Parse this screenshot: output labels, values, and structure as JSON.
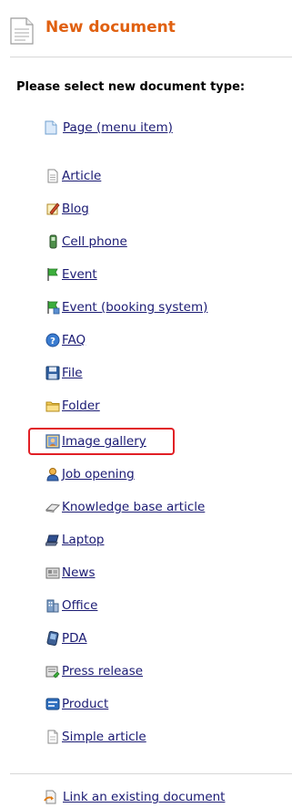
{
  "header": {
    "title": "New document",
    "icon": "document-icon"
  },
  "prompt": "Please select new document type:",
  "items": [
    {
      "label": "Page (menu item)",
      "icon": "page-icon"
    },
    {
      "label": "Article",
      "icon": "article-icon"
    },
    {
      "label": "Blog",
      "icon": "blog-icon"
    },
    {
      "label": "Cell phone",
      "icon": "cell-phone-icon"
    },
    {
      "label": "Event",
      "icon": "flag-icon"
    },
    {
      "label": "Event (booking system)",
      "icon": "booking-flag-icon"
    },
    {
      "label": "FAQ",
      "icon": "help-icon"
    },
    {
      "label": "File",
      "icon": "file-icon"
    },
    {
      "label": "Folder",
      "icon": "folder-icon"
    },
    {
      "label": "Image gallery",
      "icon": "image-gallery-icon",
      "highlighted": true
    },
    {
      "label": "Job opening",
      "icon": "person-icon"
    },
    {
      "label": "Knowledge base article",
      "icon": "knowledge-icon"
    },
    {
      "label": "Laptop",
      "icon": "laptop-icon"
    },
    {
      "label": "News",
      "icon": "news-icon"
    },
    {
      "label": "Office",
      "icon": "office-icon"
    },
    {
      "label": "PDA",
      "icon": "pda-icon"
    },
    {
      "label": "Press release",
      "icon": "press-release-icon"
    },
    {
      "label": "Product",
      "icon": "product-icon"
    },
    {
      "label": "Simple article",
      "icon": "simple-article-icon"
    }
  ],
  "footer": {
    "link_label": "Link an existing document",
    "icon": "link-icon"
  },
  "colors": {
    "title": "#e06010",
    "link": "#1a1a73",
    "highlight": "#e11f25"
  }
}
